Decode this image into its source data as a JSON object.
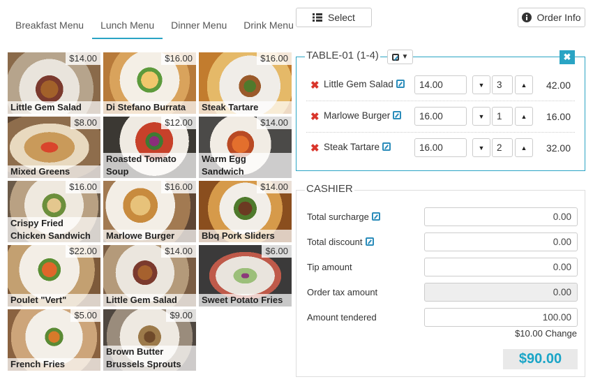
{
  "tabs": [
    {
      "label": "Breakfast Menu"
    },
    {
      "label": "Lunch Menu"
    },
    {
      "label": "Dinner Menu"
    },
    {
      "label": "Drink Menu"
    }
  ],
  "toolbar": {
    "select_label": "Select",
    "order_info_label": "Order Info",
    "select_icon": "list-icon",
    "info_icon": "info-icon"
  },
  "menu_items": [
    {
      "name": "Little Gem Salad",
      "price": "$14.00"
    },
    {
      "name": "Di Stefano Burrata",
      "price": "$16.00"
    },
    {
      "name": "Steak Tartare",
      "price": "$16.00"
    },
    {
      "name": "Mixed Greens",
      "price": "$8.00"
    },
    {
      "name": "Roasted Tomato Soup",
      "price": "$12.00"
    },
    {
      "name": "Warm Egg Sandwich",
      "price": "$14.00"
    },
    {
      "name": "Crispy Fried Chicken Sandwich",
      "price": "$16.00"
    },
    {
      "name": "Marlowe Burger",
      "price": "$16.00"
    },
    {
      "name": "Bbq Pork Sliders",
      "price": "$14.00"
    },
    {
      "name": "Poulet \"Vert\"",
      "price": "$22.00"
    },
    {
      "name": "Little Gem Salad",
      "price": "$14.00"
    },
    {
      "name": "Sweet Potato Fries",
      "price": "$6.00"
    },
    {
      "name": "French Fries",
      "price": "$5.00"
    },
    {
      "name": "Brown Butter Brussels Sprouts",
      "price": "$9.00"
    }
  ],
  "order": {
    "table_label": "TABLE-01 (1-4)",
    "close_icon": "close-icon",
    "items": [
      {
        "name": "Little Gem Salad",
        "unit_price": "14.00",
        "qty": "3",
        "total": "42.00"
      },
      {
        "name": "Marlowe Burger",
        "unit_price": "16.00",
        "qty": "1",
        "total": "16.00"
      },
      {
        "name": "Steak Tartare",
        "unit_price": "16.00",
        "qty": "2",
        "total": "32.00"
      }
    ]
  },
  "cashier": {
    "title": "CASHIER",
    "fields": [
      {
        "label": "Total surcharge",
        "value": "0.00"
      },
      {
        "label": "Total discount",
        "value": "0.00"
      },
      {
        "label": "Tip amount",
        "value": "0.00"
      },
      {
        "label": "Order tax amount",
        "value": "0.00"
      },
      {
        "label": "Amount tendered",
        "value": "100.00"
      }
    ],
    "change": "$10.00 Change",
    "total": "$90.00"
  },
  "colors": {
    "accent": "#2aa4c4",
    "remove": "#d9352b",
    "edit": "#2b8cba"
  }
}
